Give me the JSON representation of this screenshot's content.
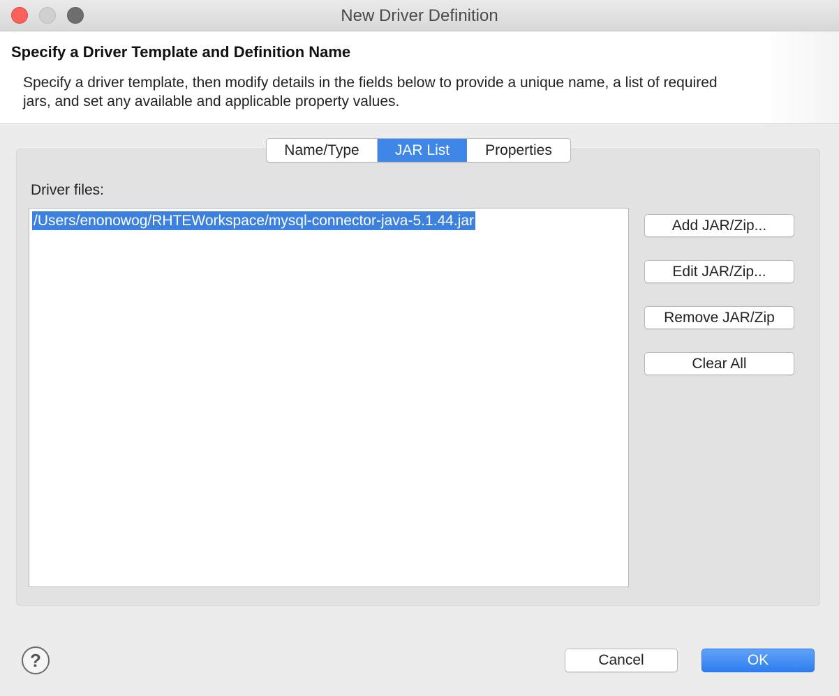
{
  "window": {
    "title": "New Driver Definition",
    "controls": {
      "close": "close-button",
      "minimize": "minimize-button",
      "zoom": "zoom-button"
    }
  },
  "header": {
    "title": "Specify a Driver Template and Definition Name",
    "description": "Specify a driver template, then modify details in the fields below to provide a unique name, a list of required jars, and set any available and applicable property values."
  },
  "tabs": [
    {
      "label": "Name/Type",
      "selected": false
    },
    {
      "label": "JAR List",
      "selected": true
    },
    {
      "label": "Properties",
      "selected": false
    }
  ],
  "jar_list": {
    "label": "Driver files:",
    "files": [
      "/Users/enonowog/RHTEWorkspace/mysql-connector-java-5.1.44.jar"
    ],
    "buttons": {
      "add": "Add JAR/Zip...",
      "edit": "Edit JAR/Zip...",
      "remove": "Remove JAR/Zip",
      "clear": "Clear All"
    }
  },
  "footer": {
    "help_glyph": "?",
    "cancel_label": "Cancel",
    "ok_label": "OK"
  },
  "colors": {
    "accent": "#3e86e8",
    "selection": "#3c80e0",
    "close": "#fc605c"
  }
}
